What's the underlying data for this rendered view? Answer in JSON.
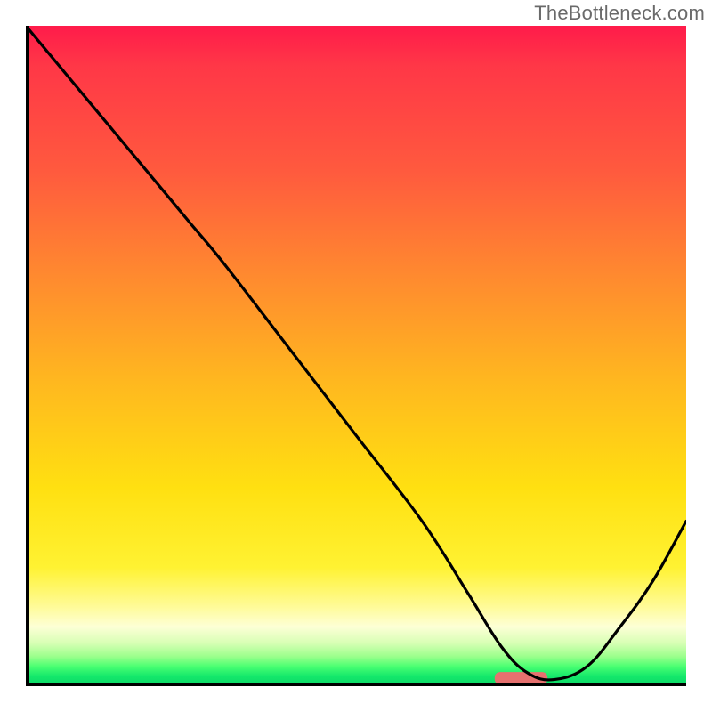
{
  "watermark": "TheBottleneck.com",
  "chart_data": {
    "type": "line",
    "title": "",
    "xlabel": "",
    "ylabel": "",
    "xlim": [
      0,
      100
    ],
    "ylim": [
      0,
      100
    ],
    "grid": false,
    "series": [
      {
        "name": "curve",
        "x": [
          0,
          10,
          20,
          25,
          30,
          40,
          50,
          60,
          67,
          72,
          76,
          80,
          85,
          90,
          95,
          100
        ],
        "y": [
          100,
          88,
          76,
          70,
          64,
          51,
          38,
          25,
          14,
          6,
          2,
          1,
          3,
          9,
          16,
          25
        ]
      }
    ],
    "marker": {
      "name": "highlight",
      "x_center": 75,
      "y": 1.2,
      "width_x": 8,
      "color": "#e6716f"
    },
    "colors": {
      "curve": "#000000",
      "axis": "#000000"
    }
  }
}
